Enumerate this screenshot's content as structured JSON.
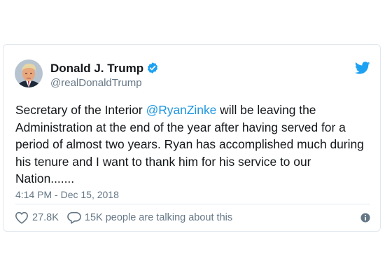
{
  "tweet": {
    "author_name": "Donald J. Trump",
    "handle": "@realDonaldTrump",
    "text_before": "Secretary of the Interior ",
    "mention": "@RyanZinke",
    "text_after": " will be leaving the Administration at the end of the year after having served for a period of almost two years. Ryan has accomplished much during his tenure and I want to thank him for his service to our Nation.......",
    "timestamp": "4:14 PM - Dec 15, 2018"
  },
  "actions": {
    "likes": "27.8K",
    "talking": "15K people are talking about this"
  },
  "icons": {
    "verified": "verified-badge-icon",
    "brand": "twitter-bird-icon",
    "like": "heart-icon",
    "reply": "speech-bubble-icon",
    "info": "info-icon"
  },
  "colors": {
    "brand_blue": "#1da1f2",
    "mention_blue": "#1b95e0",
    "text": "#14171a",
    "secondary": "#657786",
    "border": "#e1e8ed"
  }
}
